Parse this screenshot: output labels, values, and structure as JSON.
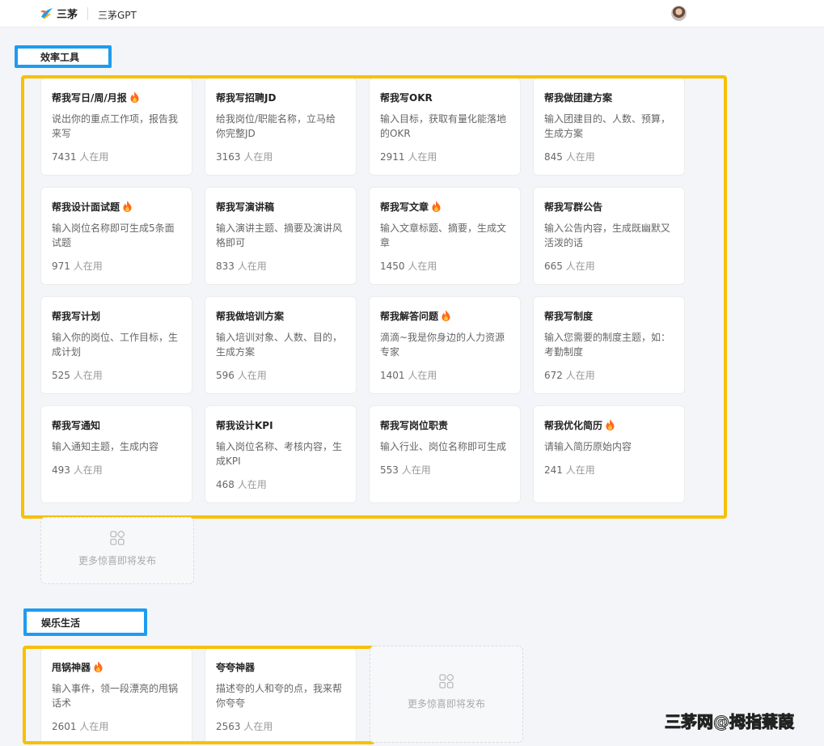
{
  "header": {
    "logo_text": "三茅",
    "app_name": "三茅GPT"
  },
  "sections": [
    {
      "title": "效率工具",
      "cards": [
        {
          "title": "帮我写日/周/月报",
          "hot": true,
          "desc": "说出你的重点工作项，报告我来写",
          "count": "7431",
          "suffix": "人在用"
        },
        {
          "title": "帮我写招聘JD",
          "hot": false,
          "desc": "给我岗位/职能名称，立马给你完整JD",
          "count": "3163",
          "suffix": "人在用"
        },
        {
          "title": "帮我写OKR",
          "hot": false,
          "desc": "输入目标，获取有量化能落地的OKR",
          "count": "2911",
          "suffix": "人在用"
        },
        {
          "title": "帮我做团建方案",
          "hot": false,
          "desc": "输入团建目的、人数、预算，生成方案",
          "count": "845",
          "suffix": "人在用"
        },
        {
          "title": "帮我设计面试题",
          "hot": true,
          "desc": "输入岗位名称即可生成5条面试题",
          "count": "971",
          "suffix": "人在用"
        },
        {
          "title": "帮我写演讲稿",
          "hot": false,
          "desc": "输入演讲主题、摘要及演讲风格即可",
          "count": "833",
          "suffix": "人在用"
        },
        {
          "title": "帮我写文章",
          "hot": true,
          "desc": "输入文章标题、摘要，生成文章",
          "count": "1450",
          "suffix": "人在用"
        },
        {
          "title": "帮我写群公告",
          "hot": false,
          "desc": "输入公告内容，生成既幽默又活泼的话",
          "count": "665",
          "suffix": "人在用"
        },
        {
          "title": "帮我写计划",
          "hot": false,
          "desc": "输入你的岗位、工作目标，生成计划",
          "count": "525",
          "suffix": "人在用"
        },
        {
          "title": "帮我做培训方案",
          "hot": false,
          "desc": "输入培训对象、人数、目的，生成方案",
          "count": "596",
          "suffix": "人在用"
        },
        {
          "title": "帮我解答问题",
          "hot": true,
          "desc": "滴滴~我是你身边的人力资源专家",
          "count": "1401",
          "suffix": "人在用"
        },
        {
          "title": "帮我写制度",
          "hot": false,
          "desc": "输入您需要的制度主题，如：考勤制度",
          "count": "672",
          "suffix": "人在用"
        },
        {
          "title": "帮我写通知",
          "hot": false,
          "desc": "输入通知主题，生成内容",
          "count": "493",
          "suffix": "人在用"
        },
        {
          "title": "帮我设计KPI",
          "hot": false,
          "desc": "输入岗位名称、考核内容，生成KPI",
          "count": "468",
          "suffix": "人在用"
        },
        {
          "title": "帮我写岗位职责",
          "hot": false,
          "desc": "输入行业、岗位名称即可生成",
          "count": "553",
          "suffix": "人在用"
        },
        {
          "title": "帮我优化简历",
          "hot": true,
          "desc": "请输入简历原始内容",
          "count": "241",
          "suffix": "人在用"
        }
      ],
      "more_text": "更多惊喜即将发布"
    },
    {
      "title": "娱乐生活",
      "cards": [
        {
          "title": "甩锅神器",
          "hot": true,
          "desc": "输入事件，领一段漂亮的甩锅话术",
          "count": "2601",
          "suffix": "人在用"
        },
        {
          "title": "夸夸神器",
          "hot": false,
          "desc": "描述夸的人和夸的点，我来帮你夸夸",
          "count": "2563",
          "suffix": "人在用"
        }
      ],
      "more_text": "更多惊喜即将发布"
    }
  ],
  "watermark": "三茅网@拇指蒹葭",
  "colors": {
    "section_highlight": "#1e9cf0",
    "grid_highlight": "#f8c000",
    "fire": "#ff6a1a"
  }
}
